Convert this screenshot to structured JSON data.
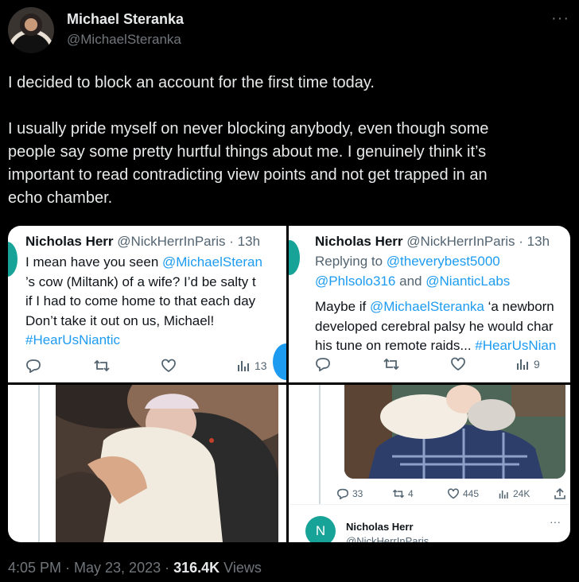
{
  "author": {
    "name": "Michael Steranka",
    "handle": "@MichaelSteranka",
    "more": "···"
  },
  "tweet": {
    "para1": "I decided to block an account for the first time today.",
    "para2_line1": "I usually pride myself on never blocking anybody, even though some",
    "para2_line2": "people say some pretty hurtful things about me. I genuinely think it’s",
    "para2_line3": "important to read contradicting view points and not get trapped in an",
    "para2_line4": "echo chamber."
  },
  "panel1": {
    "name": "Nicholas Herr",
    "handle": "@NickHerrInParis · 13h",
    "line1_pre": "I mean have you seen ",
    "line1_link": "@MichaelSteran",
    "line2": "’s cow (Miltank) of a wife? I’d be salty t",
    "line3": "if I had to come home to that each day",
    "line4": "Don’t take it out on us, Michael!",
    "hashtag": "#HearUsNiantic",
    "views": "13"
  },
  "panel2": {
    "name": "Nicholas Herr",
    "handle": "@NickHerrInParis · 13h",
    "replying": "Replying to ",
    "reply1": "@theverybest5000",
    "reply2": "@Phlsolo316",
    "and": " and ",
    "reply3": "@NianticLabs",
    "line1_pre": "Maybe if ",
    "line1_link": "@MichaelSteranka",
    "line1_post": " ‘a newborn",
    "line2": "developed cerebral palsy he would char",
    "line3_pre": "his tune on remote raids... ",
    "line3_link": "#HearUsNian",
    "views": "9"
  },
  "panel4": {
    "replies": "33",
    "retweets": "4",
    "likes": "445",
    "views": "24K",
    "reply_name": "Nicholas Herr",
    "reply_handle": "@NickHerrInParis",
    "reply_avatar_letter": "N"
  },
  "footer": {
    "time": "4:05 PM · May 23, 2023 · ",
    "views_count": "316.4K",
    "views_label": " Views"
  },
  "colors": {
    "link": "#1d9bf0",
    "muted": "#71767b",
    "accent_avatar": "#17a398"
  }
}
